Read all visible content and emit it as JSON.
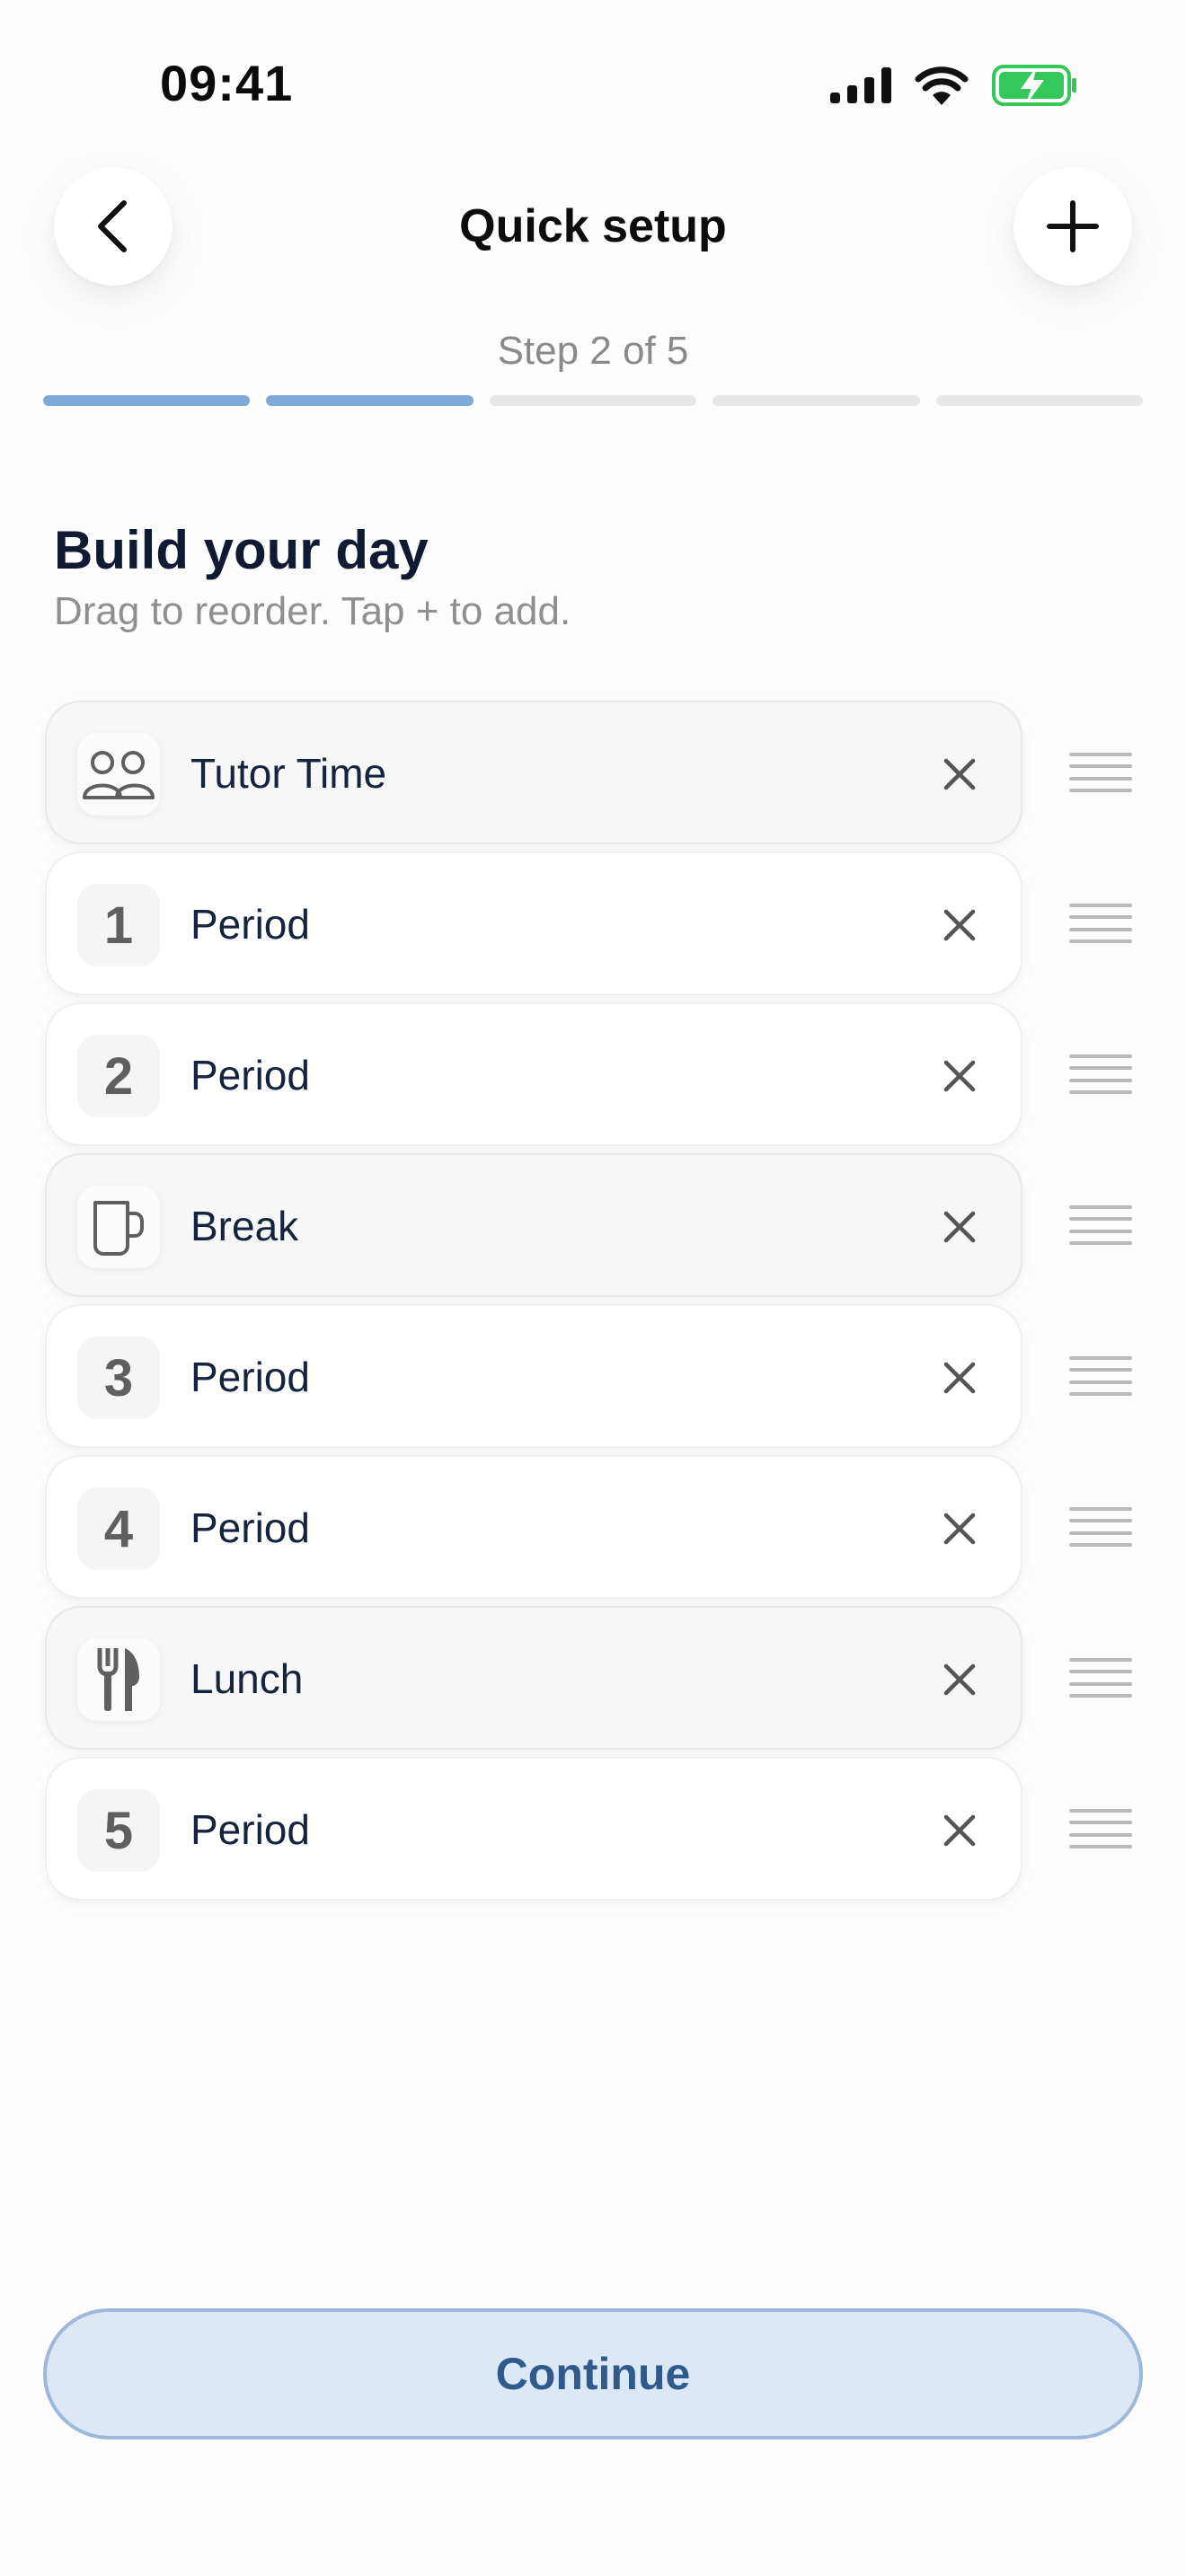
{
  "status_bar": {
    "time": "09:41"
  },
  "header": {
    "title": "Quick setup",
    "step_label": "Step 2 of 5",
    "progress": {
      "total_steps": 5,
      "completed_steps": 2
    }
  },
  "section": {
    "heading": "Build your day",
    "subheading": "Drag to reorder. Tap + to add."
  },
  "items": [
    {
      "badge": "",
      "icon": "people-icon",
      "label": "Tutor Time",
      "special": true
    },
    {
      "badge": "1",
      "icon": "",
      "label": "Period",
      "special": false
    },
    {
      "badge": "2",
      "icon": "",
      "label": "Period",
      "special": false
    },
    {
      "badge": "",
      "icon": "mug-icon",
      "label": "Break",
      "special": true
    },
    {
      "badge": "3",
      "icon": "",
      "label": "Period",
      "special": false
    },
    {
      "badge": "4",
      "icon": "",
      "label": "Period",
      "special": false
    },
    {
      "badge": "",
      "icon": "cutlery-icon",
      "label": "Lunch",
      "special": true
    },
    {
      "badge": "5",
      "icon": "",
      "label": "Period",
      "special": false
    }
  ],
  "footer": {
    "continue_label": "Continue"
  },
  "colors": {
    "accent": "#7fa9d8",
    "progress_inactive": "#e7e7e7",
    "continue_bg": "#dce8f5",
    "continue_text": "#2f5a8c",
    "battery_green": "#34c759"
  }
}
